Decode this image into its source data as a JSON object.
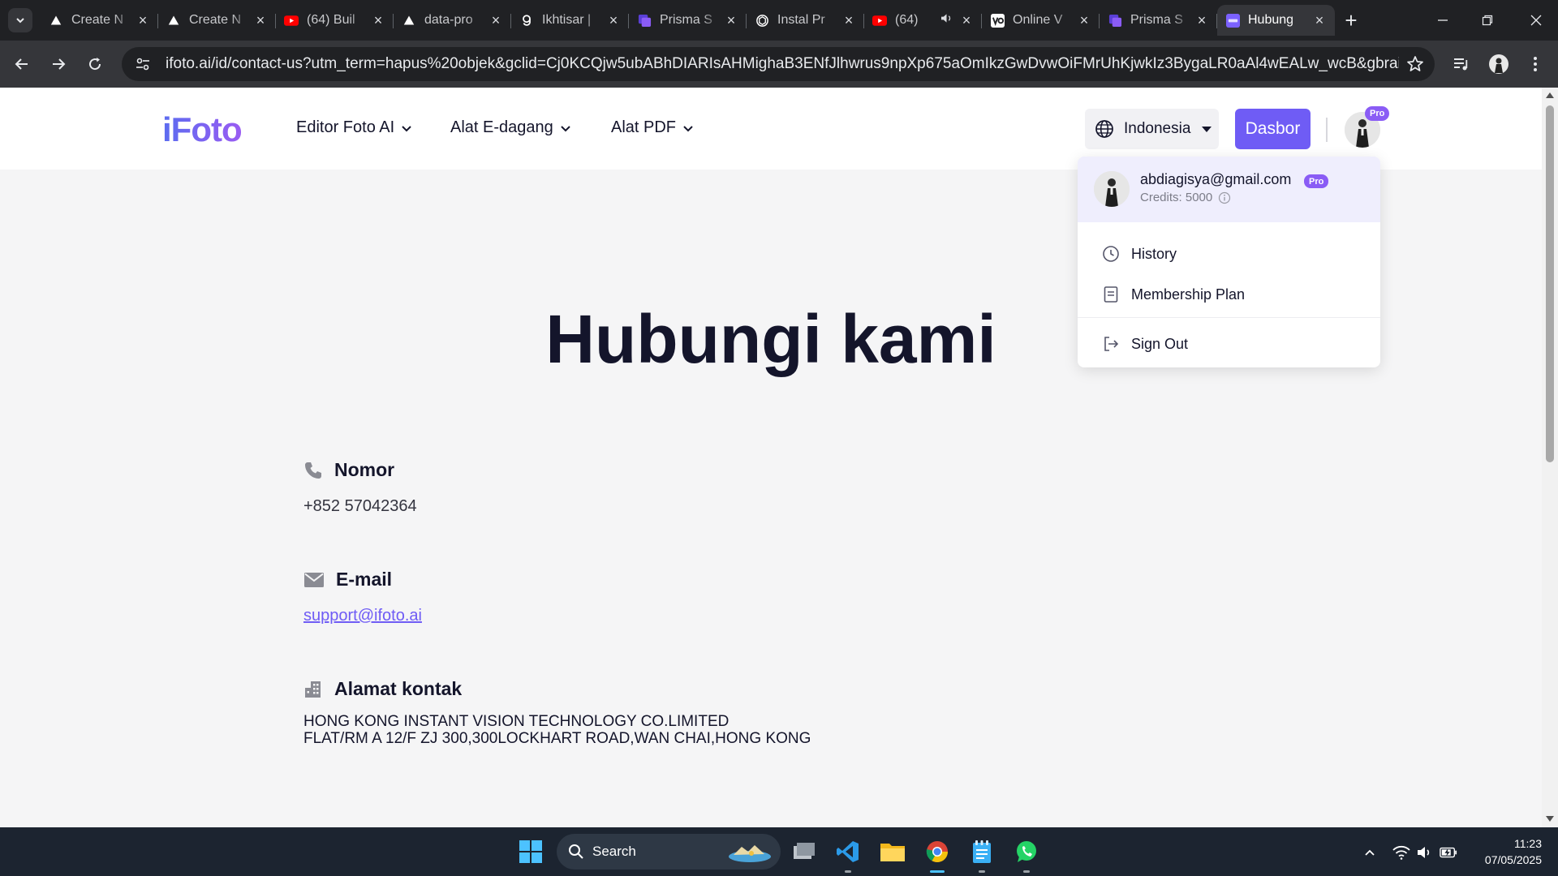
{
  "browser": {
    "tabs": [
      {
        "title": "Create N",
        "favicon": "vercel-triangle-icon",
        "favicon_color": "#ffffff"
      },
      {
        "title": "Create N",
        "favicon": "vercel-triangle-icon",
        "favicon_color": "#ffffff"
      },
      {
        "title": "(64) Buil",
        "favicon": "youtube-icon",
        "favicon_color": "#ff0000"
      },
      {
        "title": "data-pro",
        "favicon": "vercel-triangle-icon",
        "favicon_color": "#ffffff"
      },
      {
        "title": "Ikhtisar |",
        "favicon": "g-icon",
        "favicon_color": "#ffffff"
      },
      {
        "title": "Prisma S",
        "favicon": "prisma-icon",
        "favicon_color": "#8b5cf6"
      },
      {
        "title": "Instal Pr",
        "favicon": "openai-icon",
        "favicon_color": "#ffffff"
      },
      {
        "title": "(64)",
        "favicon": "youtube-icon",
        "favicon_color": "#ff0000",
        "audio": true
      },
      {
        "title": "Online V",
        "favicon": "vo-icon",
        "favicon_color": "#ffffff"
      },
      {
        "title": "Prisma S",
        "favicon": "prisma-icon",
        "favicon_color": "#8b5cf6"
      },
      {
        "title": "Hubung",
        "favicon": "ifoto-icon",
        "favicon_color": "#7b61ff",
        "active": true
      }
    ],
    "url": "ifoto.ai/id/contact-us?utm_term=hapus%20objek&gclid=Cj0KCQjw5ubABhDIARIsAHMighaB3ENfJlhwrus9npXp675aOmIkzGwDvwOiFMrUhKjwkIz3BygaLR0aAl4wEALw_wcB&gbraid=0AAAAA-b4_I..."
  },
  "navbar": {
    "logo": "iFoto",
    "menu": [
      "Editor Foto AI",
      "Alat E-dagang",
      "Alat PDF"
    ],
    "language": "Indonesia",
    "dashboard_button": "Dasbor",
    "pro_badge": "Pro"
  },
  "page": {
    "heading": "Hubungi kami",
    "phone_label": "Nomor",
    "phone_value": "+852 57042364",
    "email_label": "E-mail",
    "email_value": "support@ifoto.ai",
    "address_label": "Alamat kontak",
    "address_line1": "HONG KONG INSTANT VISION TECHNOLOGY CO.LIMITED",
    "address_line2": "FLAT/RM A 12/F ZJ 300,300LOCKHART ROAD,WAN CHAI,HONG KONG"
  },
  "user_menu": {
    "email": "abdiagisya@gmail.com",
    "pro_badge": "Pro",
    "credits": "Credits: 5000",
    "items": [
      "History",
      "Membership Plan",
      "Sign Out"
    ]
  },
  "taskbar": {
    "search_placeholder": "Search",
    "time": "11:23",
    "date": "07/05/2025"
  },
  "colors": {
    "brand": "#6f5cf5",
    "heading": "#14152b",
    "pro_badge": "#8a5cf5"
  }
}
